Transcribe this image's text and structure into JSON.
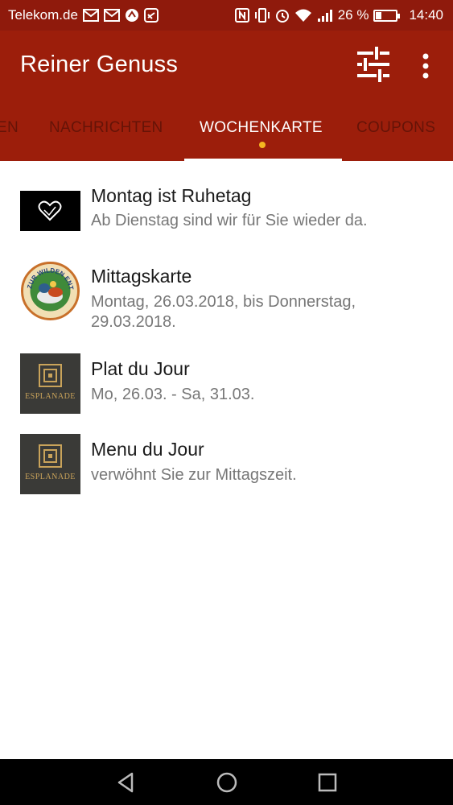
{
  "status_bar": {
    "carrier": "Telekom.de",
    "battery": "26 %",
    "battery_level": 0.26,
    "time": "14:40"
  },
  "app_bar": {
    "title": "Reiner Genuss",
    "filter_icon": "tune-icon",
    "more_icon": "more-vert-icon"
  },
  "tabs": [
    {
      "label": "EN",
      "active": false
    },
    {
      "label": "NACHRICHTEN",
      "active": false
    },
    {
      "label": "WOCHENKARTE",
      "active": true
    },
    {
      "label": "COUPONS",
      "active": false
    }
  ],
  "items": [
    {
      "title": "Montag ist Ruhetag",
      "subtitle": "Ab Dienstag sind wir für Sie wieder da.",
      "thumb": "heart-logo"
    },
    {
      "title": "Mittagskarte",
      "subtitle": "Montag, 26.03.2018, bis Donnerstag, 29.03.2018.",
      "thumb": "wilde-ente-logo",
      "logo_text": "ZUR WILDEN ENTE"
    },
    {
      "title": "Plat du Jour",
      "subtitle": "Mo, 26.03. - Sa, 31.03.",
      "thumb": "esplanade-logo",
      "logo_text": "ESPLANADE"
    },
    {
      "title": "Menu du Jour",
      "subtitle": "verwöhnt Sie zur Mittagszeit.",
      "thumb": "esplanade-logo",
      "logo_text": "ESPLANADE"
    }
  ],
  "colors": {
    "status_bar": "#8f1a0c",
    "app_bar": "#9c1e0b",
    "tab_dot": "#f5b820"
  }
}
